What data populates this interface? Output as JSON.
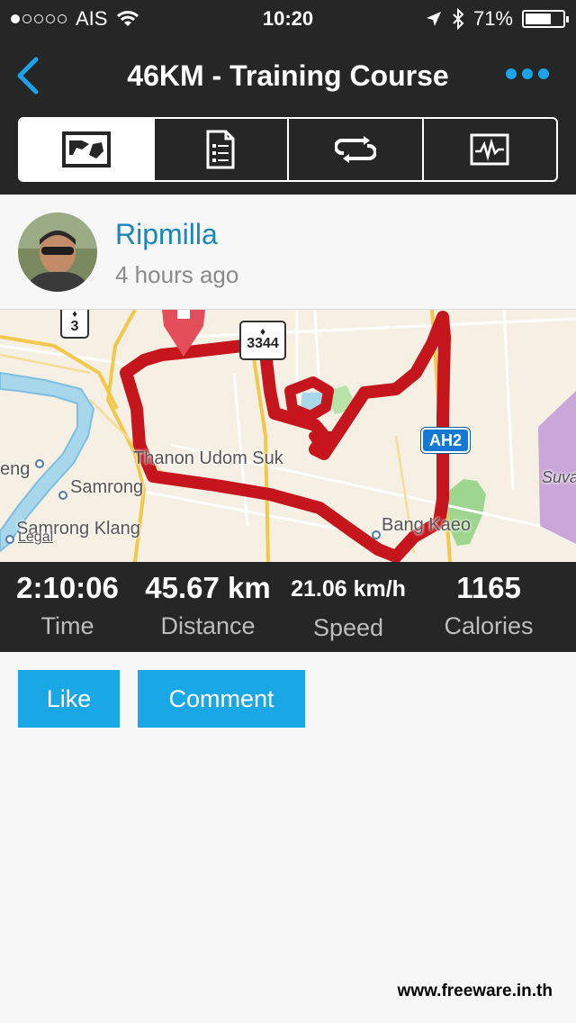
{
  "status_bar": {
    "carrier": "AIS",
    "time": "10:20",
    "battery": "71%",
    "battery_level": 0.71,
    "signal_bars_filled": 1
  },
  "nav": {
    "title": "46KM - Training Course"
  },
  "tabs": [
    {
      "icon": "map-icon",
      "active": true
    },
    {
      "icon": "document-list-icon",
      "active": false
    },
    {
      "icon": "repeat-icon",
      "active": false
    },
    {
      "icon": "activity-chart-icon",
      "active": false
    }
  ],
  "profile": {
    "name": "Ripmilla",
    "time_ago": "4 hours ago"
  },
  "map": {
    "labels": {
      "thanon": "Thanon Udom Suk",
      "samrong": "Samrong",
      "samrong_klang": "Samrong Klang",
      "bang_kaeo": "Bang Kaeo",
      "eng": "eng",
      "suva": "Suva"
    },
    "shields": {
      "route3": "3",
      "route3344": "3344",
      "ah2": "AH2"
    },
    "legal": "Legal"
  },
  "stats": [
    {
      "value": "2:10:06",
      "label": "Time"
    },
    {
      "value": "45.67 km",
      "label": "Distance"
    },
    {
      "value": "21.06 km/h",
      "label": "Speed"
    },
    {
      "value": "1165",
      "label": "Calories"
    }
  ],
  "actions": {
    "like": "Like",
    "comment": "Comment"
  },
  "footer": {
    "watermark": "www.freeware.in.th"
  },
  "colors": {
    "accent": "#19a7e6",
    "dark": "#262626",
    "route": "#c4161c",
    "link": "#1a85b8"
  }
}
